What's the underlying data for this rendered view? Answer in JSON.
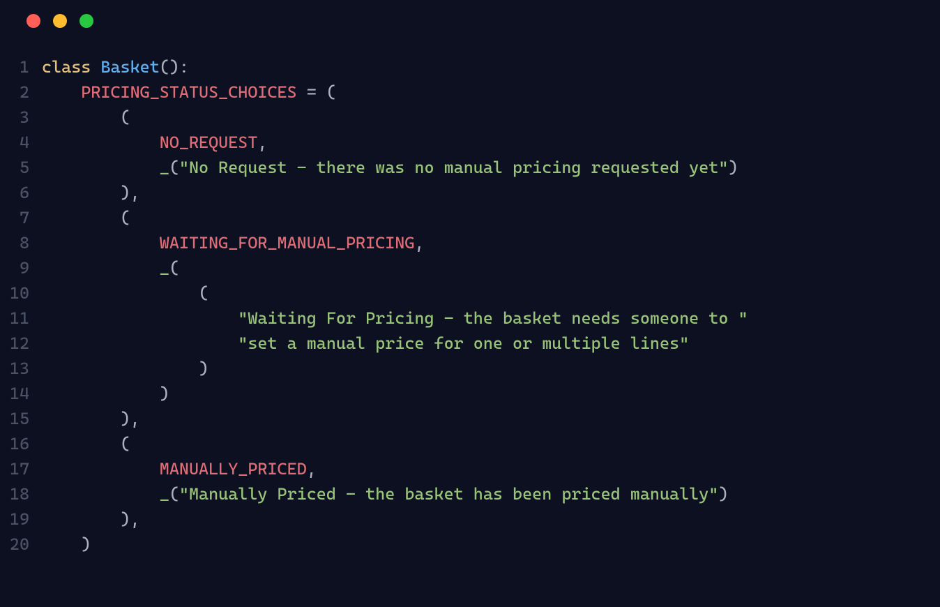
{
  "colors": {
    "background": "#0c1021",
    "keyword": "#e5c07b",
    "classname": "#61afef",
    "punct": "#abb2bf",
    "constant": "#e06c75",
    "string": "#98c379",
    "lineno": "#4b5263"
  },
  "traffic_lights": [
    "red",
    "yellow",
    "green"
  ],
  "code": {
    "lines": [
      {
        "n": 1,
        "tokens": [
          {
            "t": "class ",
            "c": "tk-keyword"
          },
          {
            "t": "Basket",
            "c": "tk-classname"
          },
          {
            "t": "():",
            "c": "tk-punct"
          }
        ]
      },
      {
        "n": 2,
        "tokens": [
          {
            "t": "    ",
            "c": "tk-punct"
          },
          {
            "t": "PRICING_STATUS_CHOICES",
            "c": "tk-const"
          },
          {
            "t": " = (",
            "c": "tk-punct"
          }
        ]
      },
      {
        "n": 3,
        "tokens": [
          {
            "t": "        (",
            "c": "tk-punct"
          }
        ]
      },
      {
        "n": 4,
        "tokens": [
          {
            "t": "            ",
            "c": "tk-punct"
          },
          {
            "t": "NO_REQUEST",
            "c": "tk-const"
          },
          {
            "t": ",",
            "c": "tk-punct"
          }
        ]
      },
      {
        "n": 5,
        "tokens": [
          {
            "t": "            ",
            "c": "tk-punct"
          },
          {
            "t": "_",
            "c": "tk-string"
          },
          {
            "t": "(",
            "c": "tk-punct"
          },
          {
            "t": "\"No Request - there was no manual pricing requested yet\"",
            "c": "tk-string"
          },
          {
            "t": ")",
            "c": "tk-punct"
          }
        ]
      },
      {
        "n": 6,
        "tokens": [
          {
            "t": "        ),",
            "c": "tk-punct"
          }
        ]
      },
      {
        "n": 7,
        "tokens": [
          {
            "t": "        (",
            "c": "tk-punct"
          }
        ]
      },
      {
        "n": 8,
        "tokens": [
          {
            "t": "            ",
            "c": "tk-punct"
          },
          {
            "t": "WAITING_FOR_MANUAL_PRICING",
            "c": "tk-const"
          },
          {
            "t": ",",
            "c": "tk-punct"
          }
        ]
      },
      {
        "n": 9,
        "tokens": [
          {
            "t": "            ",
            "c": "tk-punct"
          },
          {
            "t": "_",
            "c": "tk-string"
          },
          {
            "t": "(",
            "c": "tk-punct"
          }
        ]
      },
      {
        "n": 10,
        "tokens": [
          {
            "t": "                (",
            "c": "tk-punct"
          }
        ]
      },
      {
        "n": 11,
        "tokens": [
          {
            "t": "                    ",
            "c": "tk-punct"
          },
          {
            "t": "\"Waiting For Pricing - the basket needs someone to \"",
            "c": "tk-string"
          }
        ]
      },
      {
        "n": 12,
        "tokens": [
          {
            "t": "                    ",
            "c": "tk-punct"
          },
          {
            "t": "\"set a manual price for one or multiple lines\"",
            "c": "tk-string"
          }
        ]
      },
      {
        "n": 13,
        "tokens": [
          {
            "t": "                )",
            "c": "tk-punct"
          }
        ]
      },
      {
        "n": 14,
        "tokens": [
          {
            "t": "            )",
            "c": "tk-punct"
          }
        ]
      },
      {
        "n": 15,
        "tokens": [
          {
            "t": "        ),",
            "c": "tk-punct"
          }
        ]
      },
      {
        "n": 16,
        "tokens": [
          {
            "t": "        (",
            "c": "tk-punct"
          }
        ]
      },
      {
        "n": 17,
        "tokens": [
          {
            "t": "            ",
            "c": "tk-punct"
          },
          {
            "t": "MANUALLY_PRICED",
            "c": "tk-const"
          },
          {
            "t": ",",
            "c": "tk-punct"
          }
        ]
      },
      {
        "n": 18,
        "tokens": [
          {
            "t": "            ",
            "c": "tk-punct"
          },
          {
            "t": "_",
            "c": "tk-string"
          },
          {
            "t": "(",
            "c": "tk-punct"
          },
          {
            "t": "\"Manually Priced - the basket has been priced manually\"",
            "c": "tk-string"
          },
          {
            "t": ")",
            "c": "tk-punct"
          }
        ]
      },
      {
        "n": 19,
        "tokens": [
          {
            "t": "        ),",
            "c": "tk-punct"
          }
        ]
      },
      {
        "n": 20,
        "tokens": [
          {
            "t": "    )",
            "c": "tk-punct"
          }
        ]
      }
    ]
  }
}
